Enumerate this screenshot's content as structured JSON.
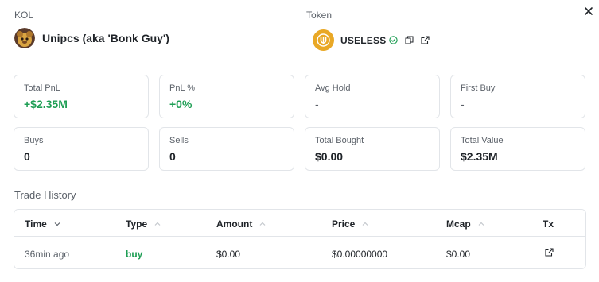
{
  "kol": {
    "section_label": "KOL",
    "name": "Unipcs (aka 'Bonk Guy')"
  },
  "token": {
    "section_label": "Token",
    "symbol": "USELESS"
  },
  "stats": [
    {
      "label": "Total PnL",
      "value": "+$2.35M"
    },
    {
      "label": "PnL %",
      "value": "+0%"
    },
    {
      "label": "Avg Hold",
      "value": "-"
    },
    {
      "label": "First Buy",
      "value": "-"
    },
    {
      "label": "Buys",
      "value": "0"
    },
    {
      "label": "Sells",
      "value": "0"
    },
    {
      "label": "Total Bought",
      "value": "$0.00"
    },
    {
      "label": "Total Value",
      "value": "$2.35M"
    }
  ],
  "trade_history": {
    "title": "Trade History",
    "columns": [
      "Time",
      "Type",
      "Amount",
      "Price",
      "Mcap",
      "Tx"
    ],
    "rows": [
      {
        "time": "36min ago",
        "type": "buy",
        "amount": "$0.00",
        "price": "$0.00000000",
        "mcap": "$0.00"
      }
    ]
  },
  "colors": {
    "positive": "#1e9e54",
    "token_brand": "#e9a826",
    "border": "#e2e5e9"
  },
  "icons": [
    "close-icon",
    "kol-avatar",
    "useless-token-logo",
    "verified-check-icon",
    "copy-icon",
    "external-link-icon",
    "sort-icon"
  ]
}
